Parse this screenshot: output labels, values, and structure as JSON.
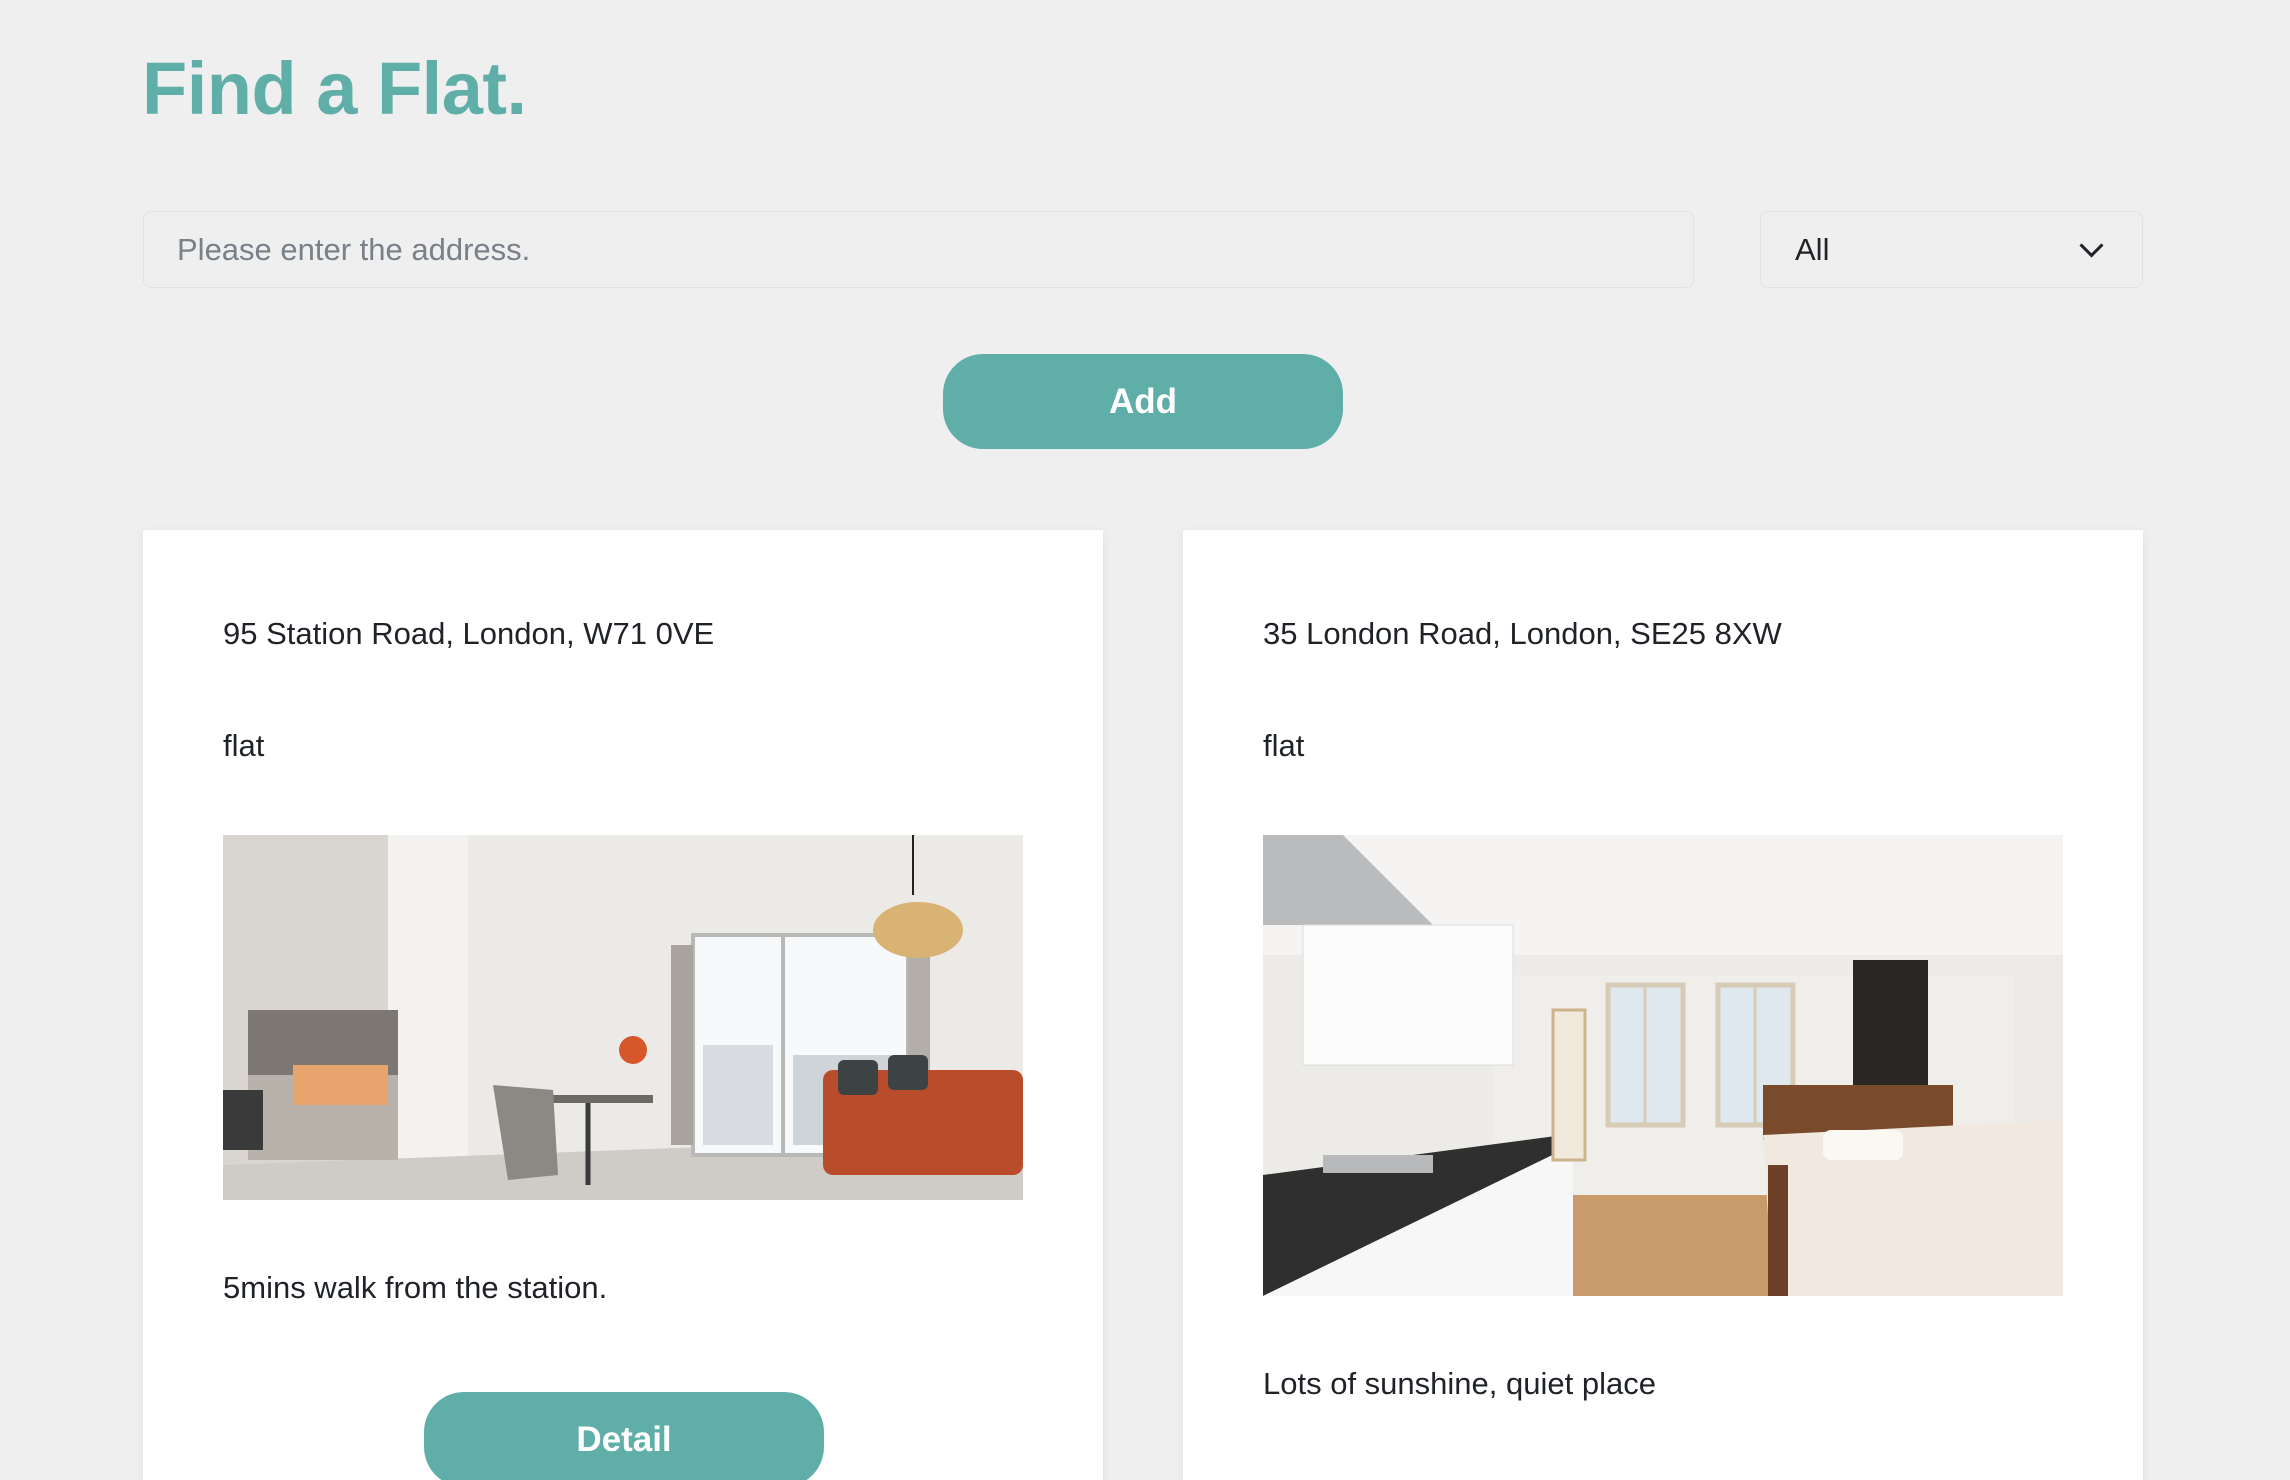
{
  "header": {
    "title": "Find a Flat."
  },
  "search": {
    "placeholder": "Please enter the address.",
    "value": ""
  },
  "filter": {
    "selected": "All",
    "icon": "chevron-down-icon"
  },
  "add_button_label": "Add",
  "listings": [
    {
      "address": "95 Station Road, London, W71 0VE",
      "type": "flat",
      "photo": "living-room-photo",
      "description": "5mins walk from the station.",
      "detail_label": "Detail"
    },
    {
      "address": "35 London Road, London, SE25 8XW",
      "type": "flat",
      "photo": "studio-kitchen-photo",
      "description": "Lots of sunshine, quiet place"
    }
  ],
  "colors": {
    "accent": "#5fafa8",
    "background": "#efefef",
    "card": "#ffffff",
    "text": "#1f2328"
  }
}
